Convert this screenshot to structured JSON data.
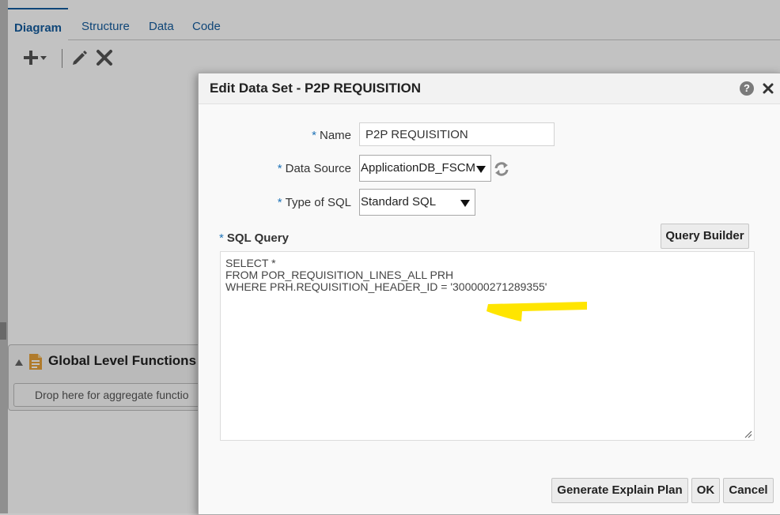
{
  "background": {
    "tabs": [
      {
        "label": "Diagram",
        "active": true
      },
      {
        "label": "Structure",
        "active": false
      },
      {
        "label": "Data",
        "active": false
      },
      {
        "label": "Code",
        "active": false
      }
    ],
    "toolbar": {
      "add_icon": "plus-icon",
      "edit_icon": "pencil-icon",
      "delete_icon": "x-icon"
    },
    "global_functions": {
      "title": "Global Level Functions",
      "drop_hint": "Drop here for aggregate functio"
    }
  },
  "dialog": {
    "title": "Edit Data Set - P2P REQUISITION",
    "help_label": "?",
    "required_mark": "*",
    "fields": {
      "name": {
        "label": "Name",
        "value": "P2P REQUISITION"
      },
      "data_source": {
        "label": "Data Source",
        "value": "ApplicationDB_FSCM"
      },
      "sql_type": {
        "label": "Type of SQL",
        "value": "Standard SQL"
      }
    },
    "sql_query": {
      "label": "SQL Query",
      "lines": [
        "SELECT *",
        "FROM POR_REQUISITION_LINES_ALL PRH",
        "WHERE PRH.REQUISITION_HEADER_ID = '300000271289355'"
      ]
    },
    "buttons": {
      "query_builder": "Query Builder",
      "explain_plan": "Generate Explain Plan",
      "ok": "OK",
      "cancel": "Cancel"
    }
  },
  "colors": {
    "accent": "#1f73b7",
    "highlight": "#ffe500"
  }
}
